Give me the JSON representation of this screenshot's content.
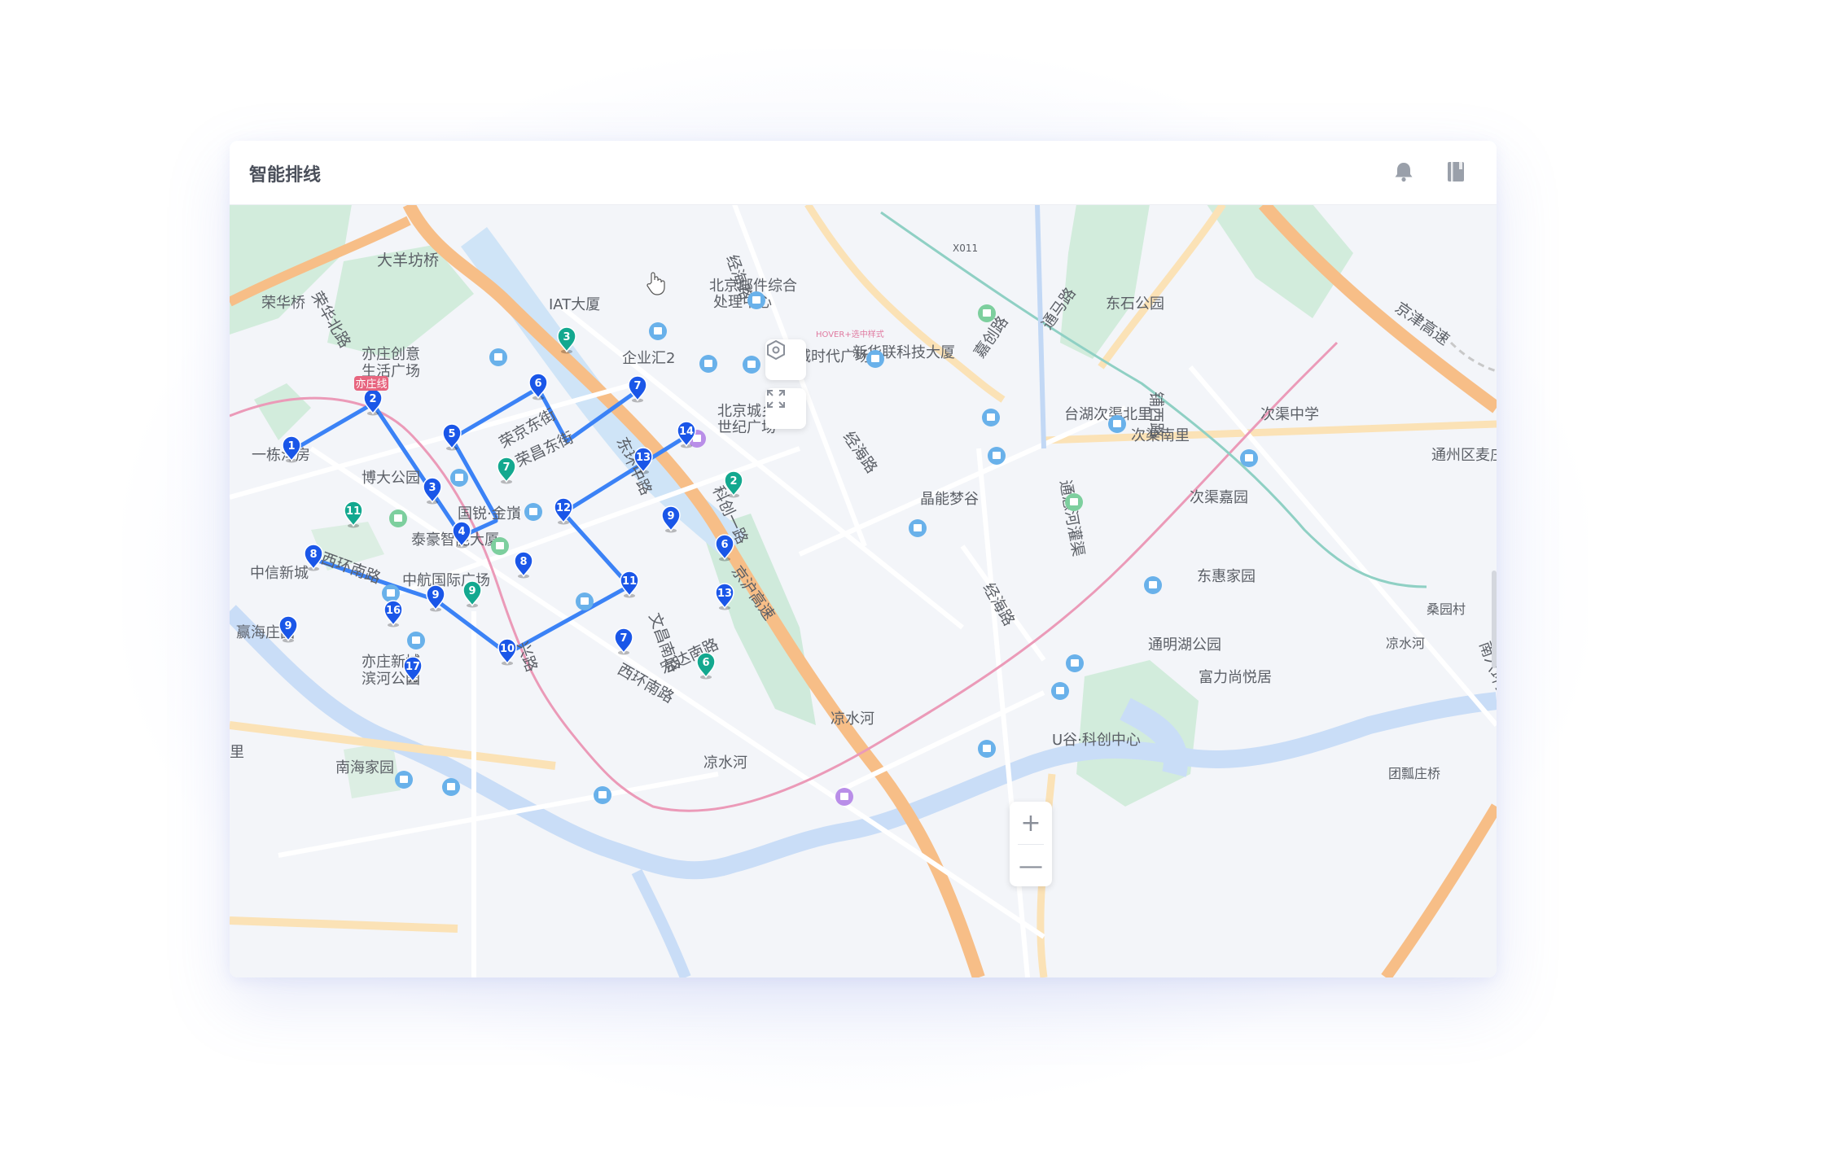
{
  "app": {
    "title": "智能排线"
  },
  "toolbar": {
    "notification_icon": "bell-icon",
    "manual_icon": "book-icon"
  },
  "map_controls": {
    "locate_icon": "hexagon-locate-icon",
    "fullscreen_icon": "fullscreen-icon",
    "zoom_in": "+",
    "zoom_out": "—"
  },
  "colors": {
    "route": "#3b82f6",
    "pin_blue": "#1a56e8",
    "pin_green": "#13a88f",
    "poi_blue": "#5aa8e6",
    "highway": "#f8c48a",
    "rail_pink": "#e88fb0",
    "water": "#c7dcf8",
    "park": "#cfeadb"
  },
  "labels": {
    "l1": "大羊坊桥",
    "l2": "荣华桥",
    "l3": "北京邮件综合",
    "l4": "处理中心",
    "l5": "IAT大厦",
    "l6": "亦庄创意",
    "l7": "生活广场",
    "l8": "企业汇2",
    "l9": "亦城时代广场",
    "l10": "新华联科技大厦",
    "l11": "东石公园",
    "l12": "北京城乡",
    "l13": "世纪广场",
    "l14": "一栋洋房",
    "l15": "博大公园",
    "l16": "台湖次渠北里",
    "l17": "次渠中学",
    "l18": "次渠南里",
    "l19": "通州区麦庄",
    "l20": "国锐·金嵿",
    "l21": "泰豪智能大厦",
    "l22": "晶能梦谷",
    "l23": "次渠嘉园",
    "l24": "中信新城",
    "l25": "中航国际广场",
    "l26": "东惠家园",
    "l27": "赢海庄园",
    "l28": "亦庄新城",
    "l29": "滨河公园",
    "l30": "桑园村",
    "l31": "通明湖公园",
    "l32": "富力尚悦居",
    "l33": "U谷·科创中心",
    "l34": "南海家园",
    "l35": "团瓢庄桥",
    "l36": "凉水河",
    "l37": "凉水河",
    "l38": "凉水河",
    "l39": "里",
    "l40": "X011",
    "l41": "HOVER+选中样式"
  },
  "roads": {
    "r1": "荣华北路",
    "r2": "经海路",
    "r3": "通马路",
    "r4": "嘉创路",
    "r5": "铺西路",
    "r6": "荣京东街",
    "r7": "东环中路",
    "r8": "京津高速",
    "r9": "通惠河灌渠",
    "r10": "经海路",
    "r11": "经海路",
    "r12": "京沪高速",
    "r13": "西环南路",
    "r14": "西环南路",
    "r15": "南六环路",
    "r16": "宏达南路",
    "r17": "科创一路",
    "r18": "文昌南路",
    "r19": "兴路",
    "r20": "荣昌东街"
  },
  "badges": {
    "rail_station": "亦庄线"
  },
  "blue_stops": [
    "1",
    "2",
    "3",
    "4",
    "5",
    "6",
    "7",
    "8",
    "9",
    "10",
    "11",
    "12",
    "13",
    "14"
  ],
  "other_pins": [
    "9",
    "16",
    "17",
    "8",
    "6",
    "13",
    "7",
    "9"
  ],
  "green_pins": [
    "3",
    "7",
    "11",
    "9",
    "2",
    "6"
  ]
}
